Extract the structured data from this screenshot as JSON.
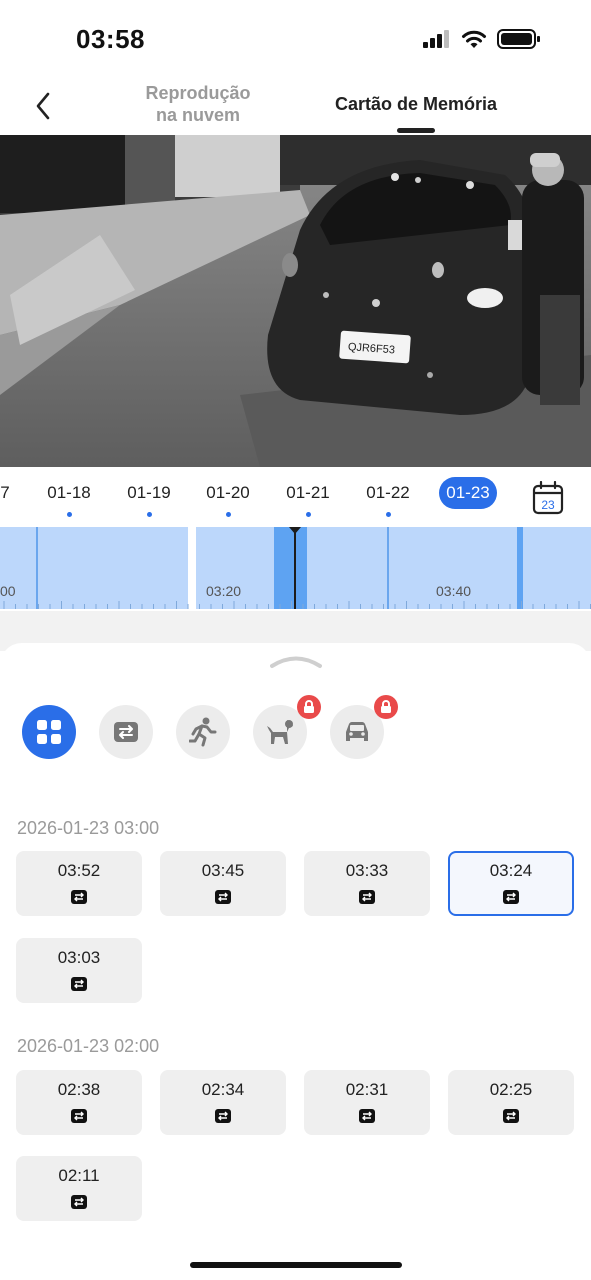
{
  "status_bar": {
    "time": "03:58"
  },
  "header": {
    "back_icon": "chevron-left-icon",
    "tabs": [
      {
        "label_line1": "Reprodução",
        "label_line2": "na nuvem",
        "active": false
      },
      {
        "label": "Cartão de Memória",
        "active": true
      }
    ]
  },
  "video": {
    "plate_text": "QJR6F53"
  },
  "dates": {
    "items": [
      {
        "label": "7",
        "has_record": false
      },
      {
        "label": "01-18",
        "has_record": true
      },
      {
        "label": "01-19",
        "has_record": true
      },
      {
        "label": "01-20",
        "has_record": true
      },
      {
        "label": "01-21",
        "has_record": true
      },
      {
        "label": "01-22",
        "has_record": true
      }
    ],
    "selected": "01-23",
    "calendar_icon": "calendar-icon",
    "calendar_day": "23"
  },
  "timeline": {
    "labels": [
      "00",
      "03:20",
      "03:40"
    ]
  },
  "filters": [
    {
      "name": "all",
      "icon": "grid-icon",
      "active": true,
      "locked": false
    },
    {
      "name": "screen",
      "icon": "swap-arrows-icon",
      "active": false,
      "locked": false
    },
    {
      "name": "person",
      "icon": "running-person-icon",
      "active": false,
      "locked": false
    },
    {
      "name": "pet",
      "icon": "dog-icon",
      "active": false,
      "locked": true
    },
    {
      "name": "vehicle",
      "icon": "car-icon",
      "active": false,
      "locked": true
    }
  ],
  "groups": [
    {
      "title": "2026-01-23 03:00",
      "clips": [
        {
          "time": "03:52",
          "selected": false
        },
        {
          "time": "03:45",
          "selected": false
        },
        {
          "time": "03:33",
          "selected": false
        },
        {
          "time": "03:24",
          "selected": true
        },
        {
          "time": "03:03",
          "selected": false
        }
      ]
    },
    {
      "title": "2026-01-23 02:00",
      "clips": [
        {
          "time": "02:38",
          "selected": false
        },
        {
          "time": "02:34",
          "selected": false
        },
        {
          "time": "02:31",
          "selected": false
        },
        {
          "time": "02:25",
          "selected": false
        },
        {
          "time": "02:11",
          "selected": false
        }
      ]
    }
  ],
  "colors": {
    "accent": "#2a6ee8",
    "timeline": "#bcd7fb",
    "lock": "#e94a4a"
  }
}
